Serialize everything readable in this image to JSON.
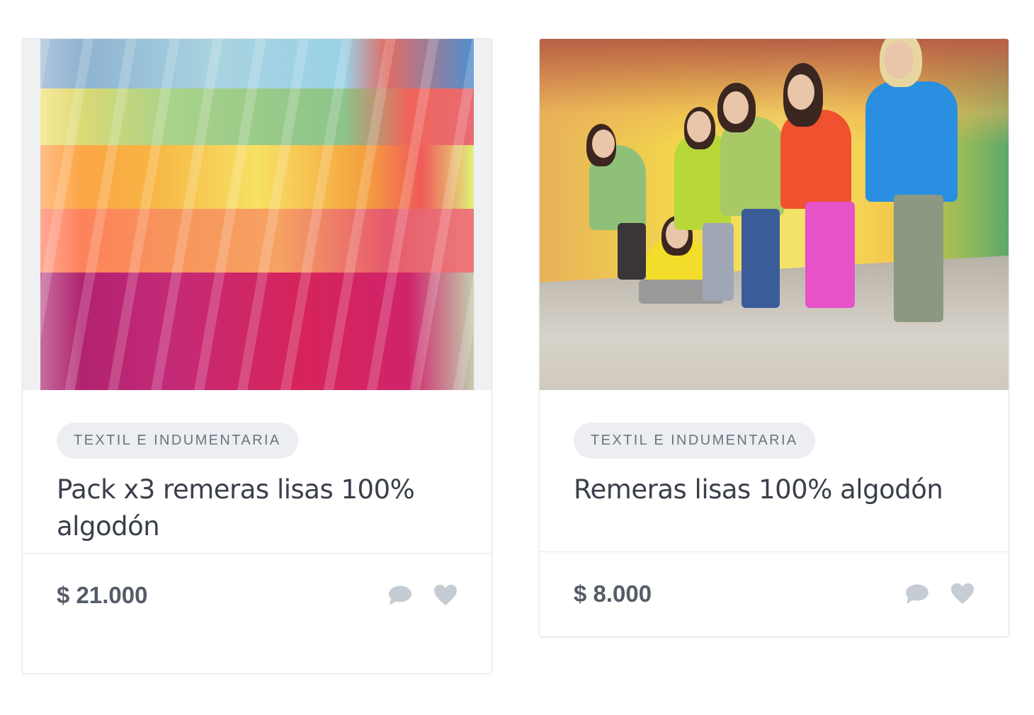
{
  "products": [
    {
      "category": "TEXTIL E INDUMENTARIA",
      "title": "Pack x3 remeras lisas 100% algodón",
      "price": "$ 21.000",
      "icons": [
        "comment-icon",
        "heart-icon"
      ]
    },
    {
      "category": "TEXTIL E INDUMENTARIA",
      "title": "Remeras lisas 100% algodón",
      "price": "$ 8.000",
      "icons": [
        "comment-icon",
        "heart-icon"
      ]
    }
  ],
  "colors": {
    "tag_bg": "#eceef1",
    "tag_text": "#6b7380",
    "title_text": "#3a3f4a",
    "price_text": "#555c68",
    "icon": "#c6ccd4",
    "border": "#e3e6ea"
  }
}
